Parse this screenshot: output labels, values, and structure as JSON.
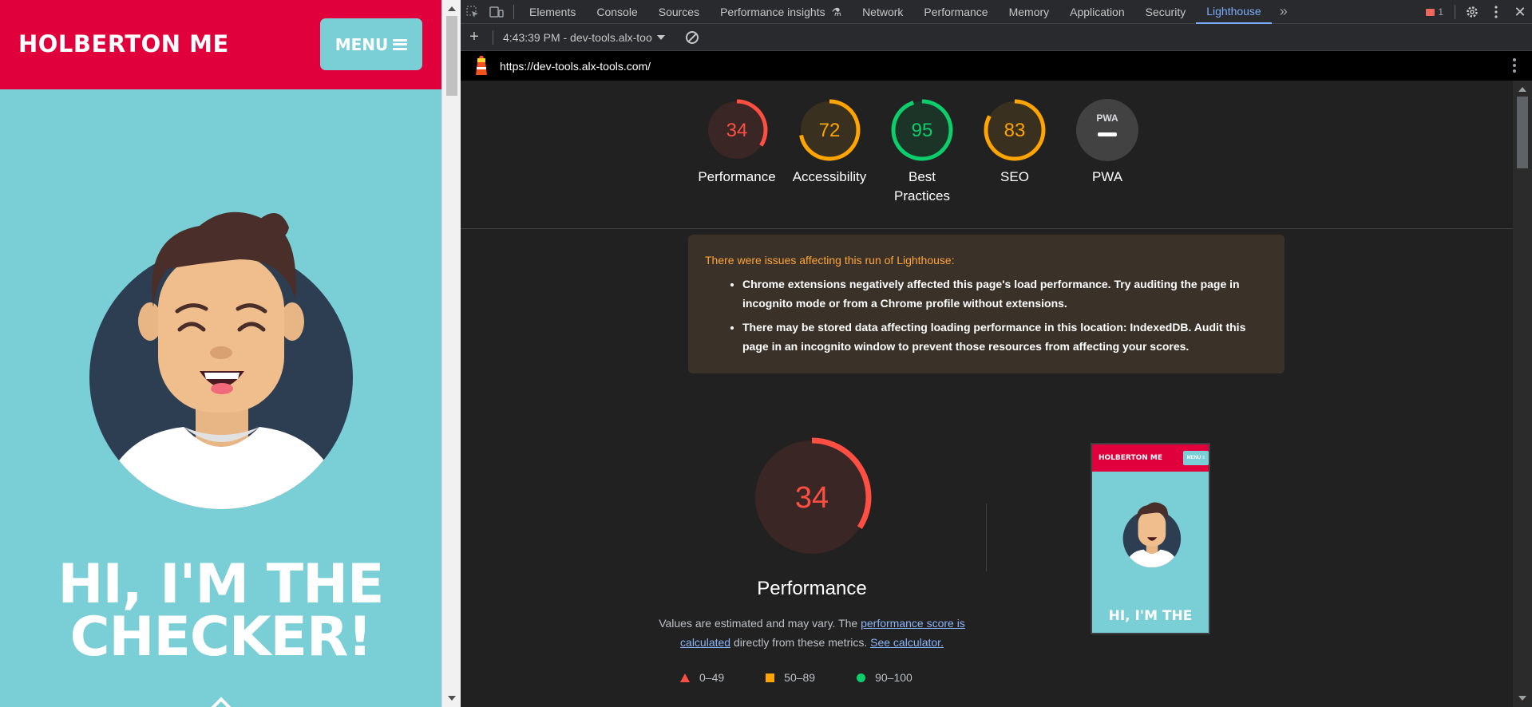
{
  "site": {
    "logo": "HOLBERTON ME",
    "menu_label": "MENU",
    "hero_line1": "HI, I'M THE",
    "hero_line2": "CHECKER!",
    "colors": {
      "header": "#e0003c",
      "background": "#7acfd6"
    }
  },
  "devtools": {
    "tabs": [
      "Elements",
      "Console",
      "Sources",
      "Performance insights",
      "Network",
      "Performance",
      "Memory",
      "Application",
      "Security",
      "Lighthouse"
    ],
    "active_tab": "Lighthouse",
    "issues_count": "1",
    "report_label": "4:43:39 PM - dev-tools.alx-too",
    "url": "https://dev-tools.alx-tools.com/"
  },
  "gauges": [
    {
      "label": "Performance",
      "score": "34",
      "color": "#ff4e42"
    },
    {
      "label": "Accessibility",
      "score": "72",
      "color": "#ffa400"
    },
    {
      "label": "Best Practices",
      "score": "95",
      "color": "#0cce6b"
    },
    {
      "label": "SEO",
      "score": "83",
      "color": "#ffa400"
    },
    {
      "label": "PWA",
      "score": "PWA",
      "color": "#9aa0a6"
    }
  ],
  "warning": {
    "heading": "There were issues affecting this run of Lighthouse:",
    "items": [
      "Chrome extensions negatively affected this page's load performance. Try auditing the page in incognito mode or from a Chrome profile without extensions.",
      "There may be stored data affecting loading performance in this location: IndexedDB. Audit this page in an incognito window to prevent those resources from affecting your scores."
    ]
  },
  "performance": {
    "score": "34",
    "title": "Performance",
    "desc_prefix": "Values are estimated and may vary. The ",
    "desc_link": "performance score is calculated",
    "desc_middle": " directly from these metrics. ",
    "desc_link2": "See calculator.",
    "legend": [
      "0–49",
      "50–89",
      "90–100"
    ]
  },
  "thumbnail": {
    "logo": "HOLBERTON ME",
    "menu": "MENU ≡",
    "hero": "HI, I'M THE"
  }
}
